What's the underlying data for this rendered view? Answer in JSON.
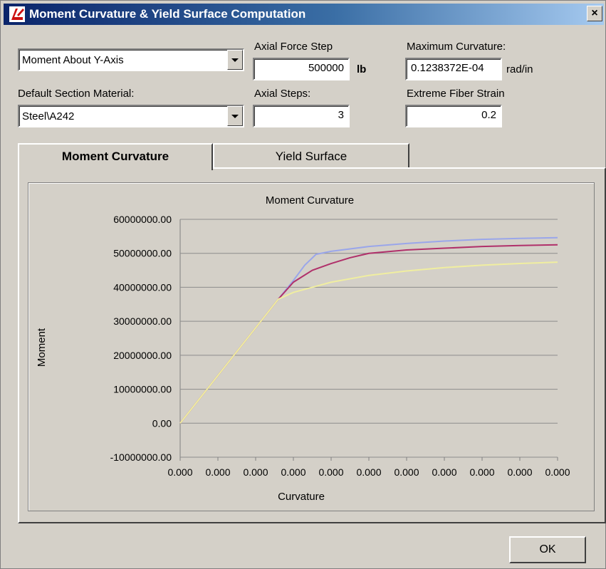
{
  "window": {
    "title": "Moment Curvature & Yield Surface Computation",
    "close_label": "×"
  },
  "controls": {
    "moment_axis": {
      "value": "Moment About Y-Axis"
    },
    "default_material": {
      "label": "Default Section Material:",
      "value": "Steel\\A242"
    },
    "axial_force_step": {
      "label": "Axial Force Step",
      "value": "500000",
      "unit": "lb"
    },
    "axial_steps": {
      "label": "Axial Steps:",
      "value": "3"
    },
    "max_curvature": {
      "label": "Maximum Curvature:",
      "value": "0.1238372E-04",
      "unit": "rad/in"
    },
    "extreme_fiber_strain": {
      "label": "Extreme Fiber Strain",
      "value": "0.2"
    }
  },
  "tabs": [
    {
      "label": "Moment Curvature",
      "active": true
    },
    {
      "label": "Yield Surface",
      "active": false
    }
  ],
  "buttons": {
    "ok_label": "OK"
  },
  "colors": {
    "series_blue": "#9aa6ea",
    "series_red": "#b0306a",
    "series_yellow": "#f0eea0",
    "gridline": "#8c8c8c"
  },
  "chart_data": {
    "type": "line",
    "title": "Moment Curvature",
    "xlabel": "Curvature",
    "ylabel": "Moment",
    "ylim": [
      -10000000,
      60000000
    ],
    "yticks": [
      "60000000.00",
      "50000000.00",
      "40000000.00",
      "30000000.00",
      "20000000.00",
      "10000000.00",
      "0.00",
      "-10000000.00"
    ],
    "ytick_values": [
      60000000,
      50000000,
      40000000,
      30000000,
      20000000,
      10000000,
      0,
      -10000000
    ],
    "xticks": [
      "0.000",
      "0.000",
      "0.000",
      "0.000",
      "0.000",
      "0.000",
      "0.000",
      "0.000",
      "0.000",
      "0.000",
      "0.000"
    ],
    "xlim": [
      0,
      10
    ],
    "grid": true,
    "legend": false,
    "series": [
      {
        "color": "#9aa6ea",
        "x": [
          0,
          2.6,
          3.0,
          3.3,
          3.6,
          4.0,
          5.0,
          6.0,
          7.0,
          8.0,
          9.0,
          10.0
        ],
        "y": [
          0,
          36500000,
          42000000,
          46500000,
          49700000,
          50600000,
          52000000,
          52900000,
          53600000,
          54100000,
          54400000,
          54600000
        ]
      },
      {
        "color": "#b0306a",
        "x": [
          0,
          2.6,
          3.0,
          3.5,
          4.0,
          4.5,
          5.0,
          6.0,
          7.0,
          8.0,
          9.0,
          10.0
        ],
        "y": [
          0,
          36500000,
          41500000,
          45000000,
          47000000,
          48700000,
          50000000,
          51000000,
          51500000,
          52000000,
          52300000,
          52500000
        ]
      },
      {
        "color": "#f0eea0",
        "x": [
          0,
          2.6,
          3.0,
          3.5,
          4.0,
          5.0,
          6.0,
          7.0,
          8.0,
          9.0,
          10.0
        ],
        "y": [
          0,
          36500000,
          38500000,
          40000000,
          41500000,
          43500000,
          44800000,
          45800000,
          46500000,
          47000000,
          47400000
        ]
      }
    ]
  }
}
